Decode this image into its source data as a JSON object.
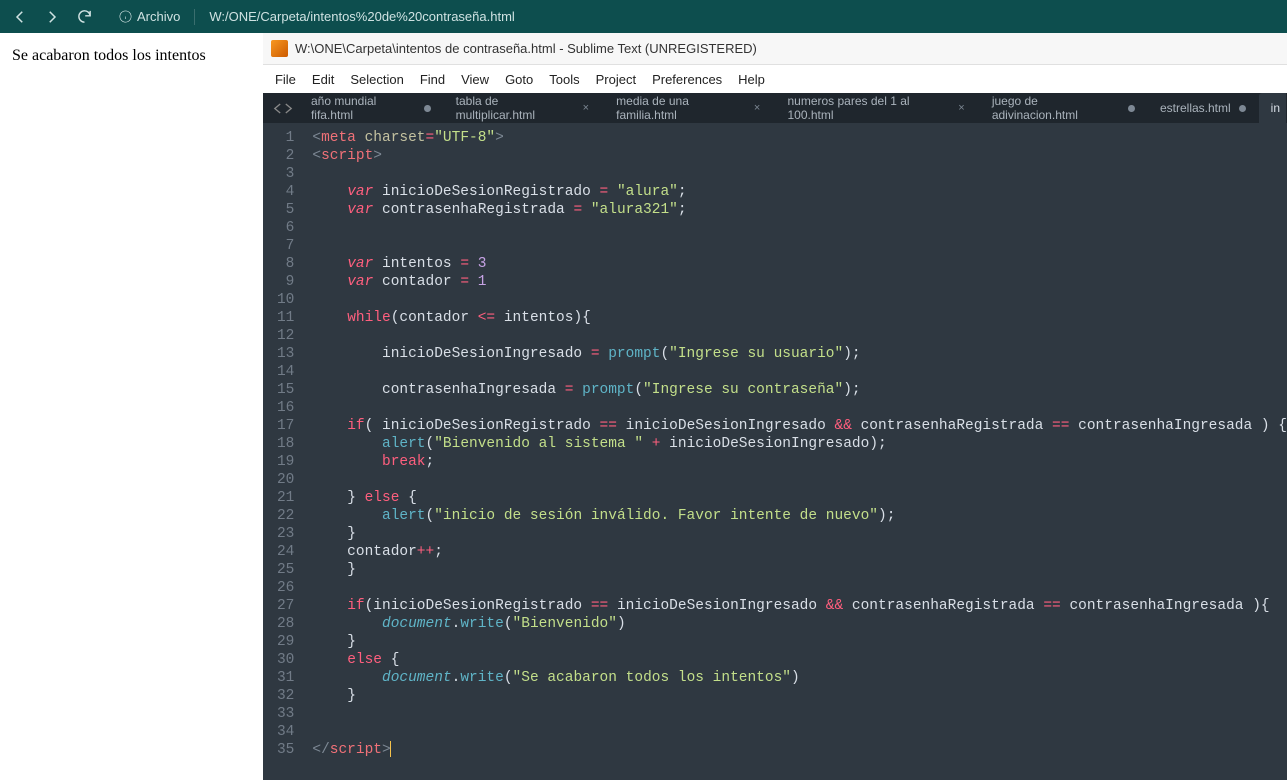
{
  "browser": {
    "url_label": "Archivo",
    "url_path": "W:/ONE/Carpeta/intentos%20de%20contraseña.html"
  },
  "page": {
    "body_text": "Se acabaron todos los intentos"
  },
  "editor": {
    "title": "W:\\ONE\\Carpeta\\intentos de contraseña.html - Sublime Text (UNREGISTERED)",
    "menu": [
      "File",
      "Edit",
      "Selection",
      "Find",
      "View",
      "Goto",
      "Tools",
      "Project",
      "Preferences",
      "Help"
    ],
    "tabs": [
      {
        "label": "año mundial fifa.html",
        "dirty": true,
        "active": false,
        "closable": false
      },
      {
        "label": "tabla de multiplicar.html",
        "dirty": false,
        "active": false,
        "closable": true
      },
      {
        "label": "media de una familia.html",
        "dirty": false,
        "active": false,
        "closable": true
      },
      {
        "label": "numeros pares del 1 al 100.html",
        "dirty": false,
        "active": false,
        "closable": true
      },
      {
        "label": "juego de adivinacion.html",
        "dirty": true,
        "active": false,
        "closable": false
      },
      {
        "label": "estrellas.html",
        "dirty": true,
        "active": false,
        "closable": false
      },
      {
        "label": "in",
        "dirty": false,
        "active": true,
        "closable": false
      }
    ],
    "line_numbers": [
      "1",
      "2",
      "3",
      "4",
      "5",
      "6",
      "7",
      "8",
      "9",
      "10",
      "11",
      "12",
      "13",
      "14",
      "15",
      "16",
      "17",
      "18",
      "19",
      "20",
      "21",
      "22",
      "23",
      "24",
      "25",
      "26",
      "27",
      "28",
      "29",
      "30",
      "31",
      "32",
      "33",
      "34",
      "35"
    ],
    "code_lines": [
      {
        "t": [
          {
            "c": "ang",
            "v": "<"
          },
          {
            "c": "tag",
            "v": "meta"
          },
          {
            "c": "plain",
            "v": " "
          },
          {
            "c": "attr",
            "v": "charset"
          },
          {
            "c": "op",
            "v": "="
          },
          {
            "c": "str",
            "v": "\"UTF-8\""
          },
          {
            "c": "ang",
            "v": ">"
          }
        ]
      },
      {
        "t": [
          {
            "c": "ang",
            "v": "<"
          },
          {
            "c": "tag",
            "v": "script"
          },
          {
            "c": "ang",
            "v": ">"
          }
        ]
      },
      {
        "t": []
      },
      {
        "t": [
          {
            "c": "plain",
            "v": "    "
          },
          {
            "c": "key2",
            "v": "var"
          },
          {
            "c": "plain",
            "v": " inicioDeSesionRegistrado "
          },
          {
            "c": "op",
            "v": "="
          },
          {
            "c": "plain",
            "v": " "
          },
          {
            "c": "str",
            "v": "\"alura\""
          },
          {
            "c": "brk",
            "v": ";"
          }
        ]
      },
      {
        "t": [
          {
            "c": "plain",
            "v": "    "
          },
          {
            "c": "key2",
            "v": "var"
          },
          {
            "c": "plain",
            "v": " contrasenhaRegistrada "
          },
          {
            "c": "op",
            "v": "="
          },
          {
            "c": "plain",
            "v": " "
          },
          {
            "c": "str",
            "v": "\"alura321\""
          },
          {
            "c": "brk",
            "v": ";"
          }
        ]
      },
      {
        "t": []
      },
      {
        "t": []
      },
      {
        "t": [
          {
            "c": "plain",
            "v": "    "
          },
          {
            "c": "key2",
            "v": "var"
          },
          {
            "c": "plain",
            "v": " intentos "
          },
          {
            "c": "op",
            "v": "="
          },
          {
            "c": "plain",
            "v": " "
          },
          {
            "c": "num",
            "v": "3"
          }
        ]
      },
      {
        "t": [
          {
            "c": "plain",
            "v": "    "
          },
          {
            "c": "key2",
            "v": "var"
          },
          {
            "c": "plain",
            "v": " contador "
          },
          {
            "c": "op",
            "v": "="
          },
          {
            "c": "plain",
            "v": " "
          },
          {
            "c": "num",
            "v": "1"
          }
        ]
      },
      {
        "t": []
      },
      {
        "t": [
          {
            "c": "plain",
            "v": "    "
          },
          {
            "c": "op",
            "v": "while"
          },
          {
            "c": "brk",
            "v": "("
          },
          {
            "c": "plain",
            "v": "contador "
          },
          {
            "c": "op",
            "v": "<="
          },
          {
            "c": "plain",
            "v": " intentos"
          },
          {
            "c": "brk",
            "v": "){"
          }
        ]
      },
      {
        "t": []
      },
      {
        "t": [
          {
            "c": "plain",
            "v": "        inicioDeSesionIngresado "
          },
          {
            "c": "op",
            "v": "="
          },
          {
            "c": "plain",
            "v": " "
          },
          {
            "c": "fn",
            "v": "prompt"
          },
          {
            "c": "brk",
            "v": "("
          },
          {
            "c": "str",
            "v": "\"Ingrese su usuario\""
          },
          {
            "c": "brk",
            "v": ");"
          }
        ]
      },
      {
        "t": []
      },
      {
        "t": [
          {
            "c": "plain",
            "v": "        contrasenhaIngresada "
          },
          {
            "c": "op",
            "v": "="
          },
          {
            "c": "plain",
            "v": " "
          },
          {
            "c": "fn",
            "v": "prompt"
          },
          {
            "c": "brk",
            "v": "("
          },
          {
            "c": "str",
            "v": "\"Ingrese su contraseña\""
          },
          {
            "c": "brk",
            "v": ");"
          }
        ]
      },
      {
        "t": []
      },
      {
        "t": [
          {
            "c": "plain",
            "v": "    "
          },
          {
            "c": "op",
            "v": "if"
          },
          {
            "c": "brk",
            "v": "("
          },
          {
            "c": "plain",
            "v": " inicioDeSesionRegistrado "
          },
          {
            "c": "op",
            "v": "=="
          },
          {
            "c": "plain",
            "v": " inicioDeSesionIngresado "
          },
          {
            "c": "op",
            "v": "&&"
          },
          {
            "c": "plain",
            "v": " contrasenhaRegistrada "
          },
          {
            "c": "op",
            "v": "=="
          },
          {
            "c": "plain",
            "v": " contrasenhaIngresada "
          },
          {
            "c": "brk",
            "v": ") {"
          }
        ]
      },
      {
        "t": [
          {
            "c": "plain",
            "v": "        "
          },
          {
            "c": "fn",
            "v": "alert"
          },
          {
            "c": "brk",
            "v": "("
          },
          {
            "c": "str",
            "v": "\"Bienvenido al sistema \""
          },
          {
            "c": "plain",
            "v": " "
          },
          {
            "c": "op",
            "v": "+"
          },
          {
            "c": "plain",
            "v": " inicioDeSesionIngresado"
          },
          {
            "c": "brk",
            "v": ");"
          }
        ]
      },
      {
        "t": [
          {
            "c": "plain",
            "v": "        "
          },
          {
            "c": "op",
            "v": "break"
          },
          {
            "c": "brk",
            "v": ";"
          }
        ]
      },
      {
        "t": []
      },
      {
        "t": [
          {
            "c": "plain",
            "v": "    "
          },
          {
            "c": "brk",
            "v": "}"
          },
          {
            "c": "plain",
            "v": " "
          },
          {
            "c": "op",
            "v": "else"
          },
          {
            "c": "plain",
            "v": " "
          },
          {
            "c": "brk",
            "v": "{"
          }
        ]
      },
      {
        "t": [
          {
            "c": "plain",
            "v": "        "
          },
          {
            "c": "fn",
            "v": "alert"
          },
          {
            "c": "brk",
            "v": "("
          },
          {
            "c": "str",
            "v": "\"inicio de sesión inválido. Favor intente de nuevo\""
          },
          {
            "c": "brk",
            "v": ");"
          }
        ]
      },
      {
        "t": [
          {
            "c": "plain",
            "v": "    "
          },
          {
            "c": "brk",
            "v": "}"
          }
        ]
      },
      {
        "t": [
          {
            "c": "plain",
            "v": "    contador"
          },
          {
            "c": "op",
            "v": "++"
          },
          {
            "c": "brk",
            "v": ";"
          }
        ]
      },
      {
        "t": [
          {
            "c": "plain",
            "v": "    "
          },
          {
            "c": "brk",
            "v": "}"
          }
        ]
      },
      {
        "t": []
      },
      {
        "t": [
          {
            "c": "plain",
            "v": "    "
          },
          {
            "c": "op",
            "v": "if"
          },
          {
            "c": "brk",
            "v": "("
          },
          {
            "c": "plain",
            "v": "inicioDeSesionRegistrado "
          },
          {
            "c": "op",
            "v": "=="
          },
          {
            "c": "plain",
            "v": " inicioDeSesionIngresado "
          },
          {
            "c": "op",
            "v": "&&"
          },
          {
            "c": "plain",
            "v": " contrasenhaRegistrada "
          },
          {
            "c": "op",
            "v": "=="
          },
          {
            "c": "plain",
            "v": " contrasenhaIngresada "
          },
          {
            "c": "brk",
            "v": "){"
          }
        ]
      },
      {
        "t": [
          {
            "c": "plain",
            "v": "        "
          },
          {
            "c": "obj",
            "v": "document"
          },
          {
            "c": "brk",
            "v": "."
          },
          {
            "c": "fn",
            "v": "write"
          },
          {
            "c": "brk",
            "v": "("
          },
          {
            "c": "str",
            "v": "\"Bienvenido\""
          },
          {
            "c": "brk",
            "v": ")"
          }
        ]
      },
      {
        "t": [
          {
            "c": "plain",
            "v": "    "
          },
          {
            "c": "brk",
            "v": "}"
          }
        ]
      },
      {
        "t": [
          {
            "c": "plain",
            "v": "    "
          },
          {
            "c": "op",
            "v": "else"
          },
          {
            "c": "plain",
            "v": " "
          },
          {
            "c": "brk",
            "v": "{"
          }
        ]
      },
      {
        "t": [
          {
            "c": "plain",
            "v": "        "
          },
          {
            "c": "obj",
            "v": "document"
          },
          {
            "c": "brk",
            "v": "."
          },
          {
            "c": "fn",
            "v": "write"
          },
          {
            "c": "brk",
            "v": "("
          },
          {
            "c": "str",
            "v": "\"Se acabaron todos los intentos\""
          },
          {
            "c": "brk",
            "v": ")"
          }
        ]
      },
      {
        "t": [
          {
            "c": "plain",
            "v": "    "
          },
          {
            "c": "brk",
            "v": "}"
          }
        ]
      },
      {
        "t": []
      },
      {
        "t": []
      },
      {
        "t": [
          {
            "c": "ang",
            "v": "</"
          },
          {
            "c": "tag",
            "v": "script"
          },
          {
            "c": "ang",
            "v": ">"
          }
        ],
        "cursor": true
      }
    ]
  }
}
